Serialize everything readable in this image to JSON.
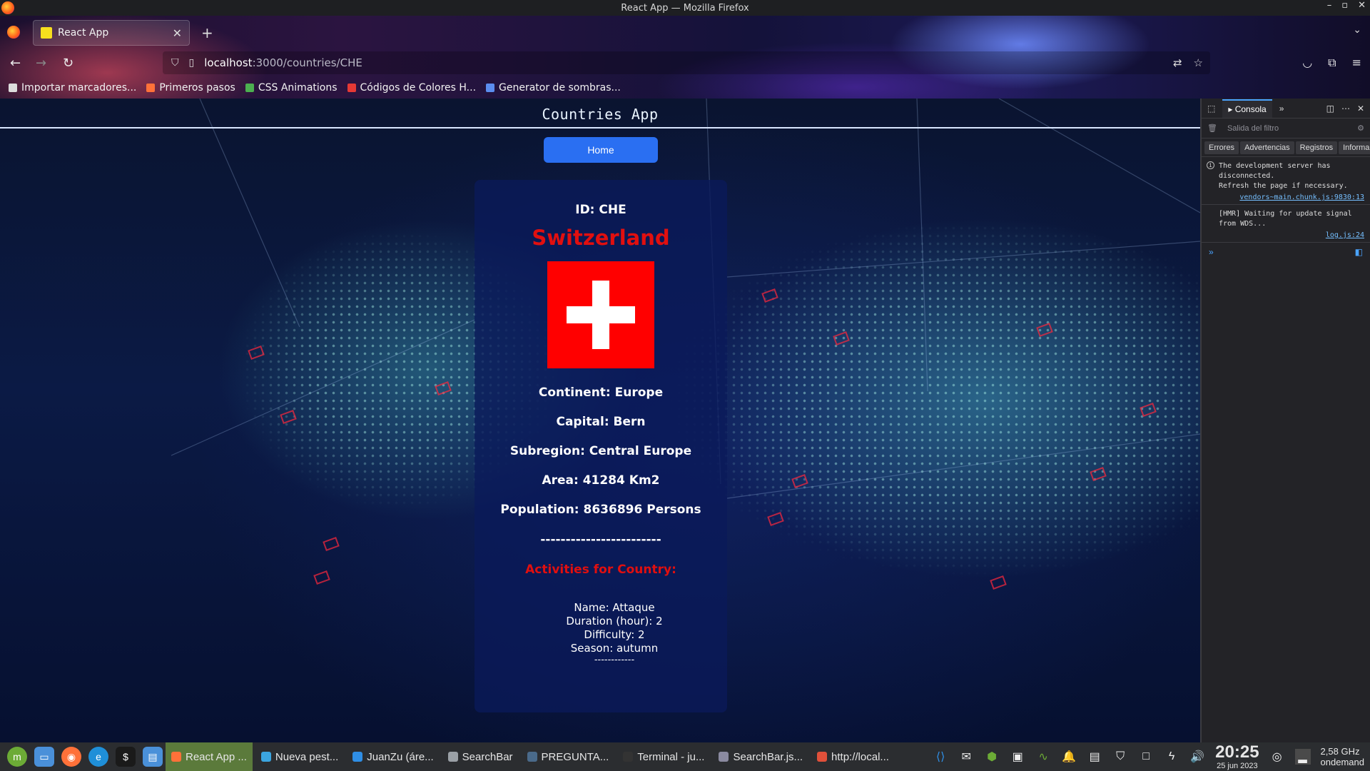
{
  "window": {
    "title": "React App — Mozilla Firefox",
    "controls": [
      "–",
      "▫",
      "✕"
    ]
  },
  "tabs": [
    {
      "label": "React App",
      "active": true
    }
  ],
  "urlbar": {
    "host": "localhost",
    "path": ":3000/countries/CHE"
  },
  "bookmarks": [
    {
      "label": "Importar marcadores...",
      "color": "#dddddd"
    },
    {
      "label": "Primeros pasos",
      "color": "#ff7139"
    },
    {
      "label": "CSS Animations",
      "color": "#4caf50"
    },
    {
      "label": "Códigos de Colores H...",
      "color": "#e53935"
    },
    {
      "label": "Generator de sombras...",
      "color": "#5b8def"
    }
  ],
  "app": {
    "title": "Countries App",
    "home_label": "Home"
  },
  "country": {
    "id": "ID: CHE",
    "name": "Switzerland",
    "continent": "Continent: Europe",
    "capital": "Capital: Bern",
    "subregion": "Subregion: Central Europe",
    "area": "Area: 41284 Km2",
    "population": "Population: 8636896 Persons",
    "separator": "------------------------",
    "activities_title": "Activities for Country:",
    "activities": [
      {
        "name": "Name: Attaque",
        "duration": "Duration (hour): 2",
        "difficulty": "Difficulty: 2",
        "season": "Season: autumn",
        "separator": "------------"
      }
    ]
  },
  "devtools": {
    "active_tab": "Consola",
    "filter_placeholder": "Salida del filtro",
    "levels": [
      "Errores",
      "Advertencias",
      "Registros",
      "Informa"
    ],
    "messages": [
      {
        "text": "The development server has disconnected.\nRefresh the page if necessary.",
        "source": "vendors~main.chunk.js:9830:13"
      },
      {
        "text": "[HMR] Waiting for update signal from WDS...",
        "source": "log.js:24"
      }
    ]
  },
  "taskbar": {
    "tasks": [
      {
        "label": "React App ...",
        "active": true,
        "color": "#ff7139"
      },
      {
        "label": "Nueva pest...",
        "active": false,
        "color": "#3ba5e0"
      },
      {
        "label": "JuanZu (áre...",
        "active": false,
        "color": "#2f8ee5"
      },
      {
        "label": "SearchBar",
        "active": false,
        "color": "#9aa0a6"
      },
      {
        "label": "PREGUNTA...",
        "active": false,
        "color": "#4a6a8a"
      },
      {
        "label": "Terminal - ju...",
        "active": false,
        "color": "#333333"
      },
      {
        "label": "SearchBar.js...",
        "active": false,
        "color": "#8a8aa0"
      },
      {
        "label": "http://local...",
        "active": false,
        "color": "#e0503a"
      }
    ],
    "time": "20:25",
    "date": "25 jun 2023",
    "cpu_freq": "2,58 GHz",
    "cpu_mode": "ondemand"
  }
}
